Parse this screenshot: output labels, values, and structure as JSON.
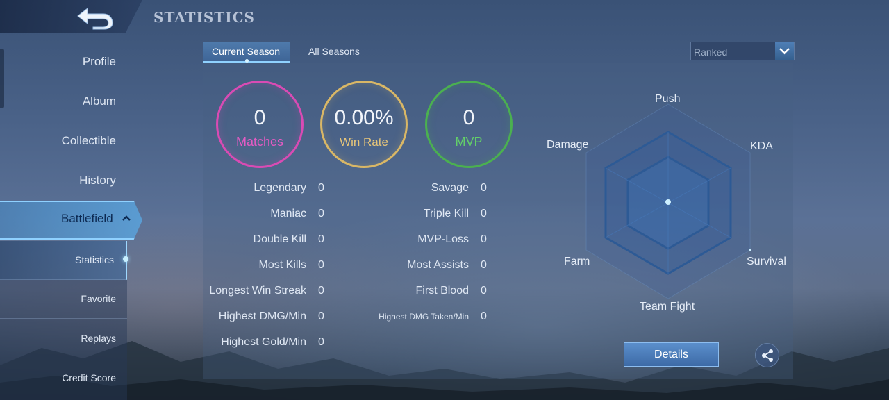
{
  "header": {
    "title": "STATISTICS"
  },
  "sidebar": {
    "items": [
      {
        "label": "Profile"
      },
      {
        "label": "Album"
      },
      {
        "label": "Collectible"
      },
      {
        "label": "History"
      },
      {
        "label": "Battlefield"
      }
    ],
    "subitems": [
      {
        "label": "Statistics"
      },
      {
        "label": "Favorite"
      },
      {
        "label": "Replays"
      },
      {
        "label": "Credit Score"
      }
    ]
  },
  "tabs": [
    {
      "label": "Current Season"
    },
    {
      "label": "All Seasons"
    }
  ],
  "mode_select": {
    "value": "Ranked"
  },
  "summary": {
    "matches": {
      "value": "0",
      "label": "Matches"
    },
    "win_rate": {
      "value": "0.00%",
      "label": "Win Rate"
    },
    "mvp": {
      "value": "0",
      "label": "MVP"
    }
  },
  "stats_left": [
    {
      "label": "Legendary",
      "value": "0"
    },
    {
      "label": "Maniac",
      "value": "0"
    },
    {
      "label": "Double Kill",
      "value": "0"
    },
    {
      "label": "Most Kills",
      "value": "0"
    },
    {
      "label": "Longest Win Streak",
      "value": "0"
    },
    {
      "label": "Highest DMG/Min",
      "value": "0"
    },
    {
      "label": "Highest Gold/Min",
      "value": "0"
    }
  ],
  "stats_right": [
    {
      "label": "Savage",
      "value": "0"
    },
    {
      "label": "Triple Kill",
      "value": "0"
    },
    {
      "label": "MVP-Loss",
      "value": "0"
    },
    {
      "label": "Most Assists",
      "value": "0"
    },
    {
      "label": "First Blood",
      "value": "0"
    },
    {
      "label": "Highest DMG Taken/Min",
      "value": "0"
    }
  ],
  "radar": {
    "axes": [
      "Push",
      "KDA",
      "Survival",
      "Team Fight",
      "Farm",
      "Damage"
    ]
  },
  "actions": {
    "details_label": "Details"
  },
  "colors": {
    "matches": "#d94bb4",
    "win_rate": "#d9b766",
    "mvp": "#4bb050",
    "accent": "#8fd1ff"
  },
  "icons": {
    "back": "back-arrow-icon",
    "dropdown": "chevron-down-icon",
    "collapse": "chevron-up-icon",
    "share": "share-icon"
  }
}
